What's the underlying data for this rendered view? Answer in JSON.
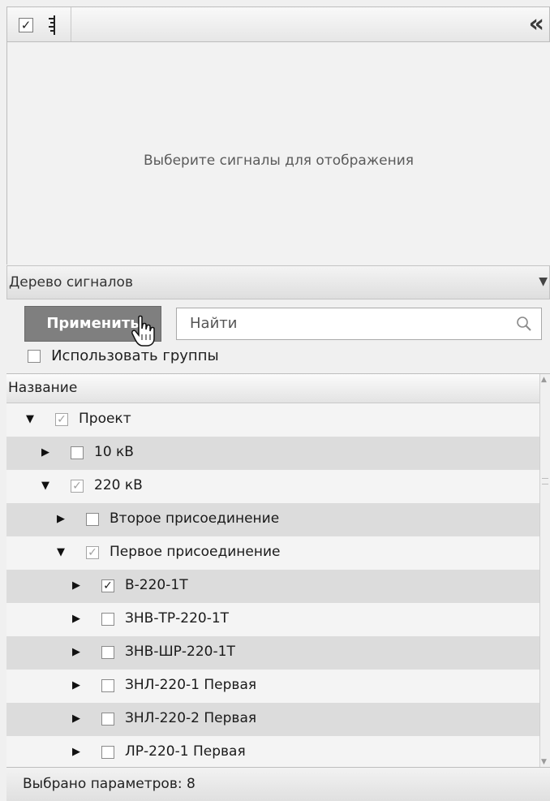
{
  "toolbar": {
    "show_all_checked": true,
    "icons": [
      "checkbox-icon",
      "ruler-icon",
      "collapse-double-chevron-icon"
    ],
    "collapse_glyph": "«"
  },
  "preview": {
    "message": "Выберите сигналы для отображения"
  },
  "signal_tree": {
    "title": "Дерево сигналов",
    "apply_label": "Применить",
    "search_placeholder": "Найти",
    "use_groups_label": "Использовать группы",
    "use_groups_checked": false,
    "column_header": "Название",
    "rows": [
      {
        "label": "Проект",
        "level": 0,
        "expanded": true,
        "check": "partial"
      },
      {
        "label": "10 кВ",
        "level": 1,
        "expanded": false,
        "check": "unchecked"
      },
      {
        "label": "220 кВ",
        "level": 1,
        "expanded": true,
        "check": "partial"
      },
      {
        "label": "Второе присоединение",
        "level": 2,
        "expanded": false,
        "check": "unchecked"
      },
      {
        "label": "Первое присоединение",
        "level": 2,
        "expanded": true,
        "check": "partial"
      },
      {
        "label": "В-220-1Т",
        "level": 3,
        "expanded": false,
        "check": "checked"
      },
      {
        "label": "ЗНВ-ТР-220-1Т",
        "level": 3,
        "expanded": false,
        "check": "unchecked"
      },
      {
        "label": "ЗНВ-ШР-220-1Т",
        "level": 3,
        "expanded": false,
        "check": "unchecked"
      },
      {
        "label": "ЗНЛ-220-1 Первая",
        "level": 3,
        "expanded": false,
        "check": "unchecked"
      },
      {
        "label": "ЗНЛ-220-2 Первая",
        "level": 3,
        "expanded": false,
        "check": "unchecked"
      },
      {
        "label": "ЛР-220-1 Первая",
        "level": 3,
        "expanded": false,
        "check": "unchecked"
      }
    ]
  },
  "status_bar": {
    "text": "Выбрано параметров: 8"
  },
  "colors": {
    "apply_button": "#7f7f7f",
    "row_alt": "#dcdcdc",
    "row": "#f4f4f4"
  }
}
